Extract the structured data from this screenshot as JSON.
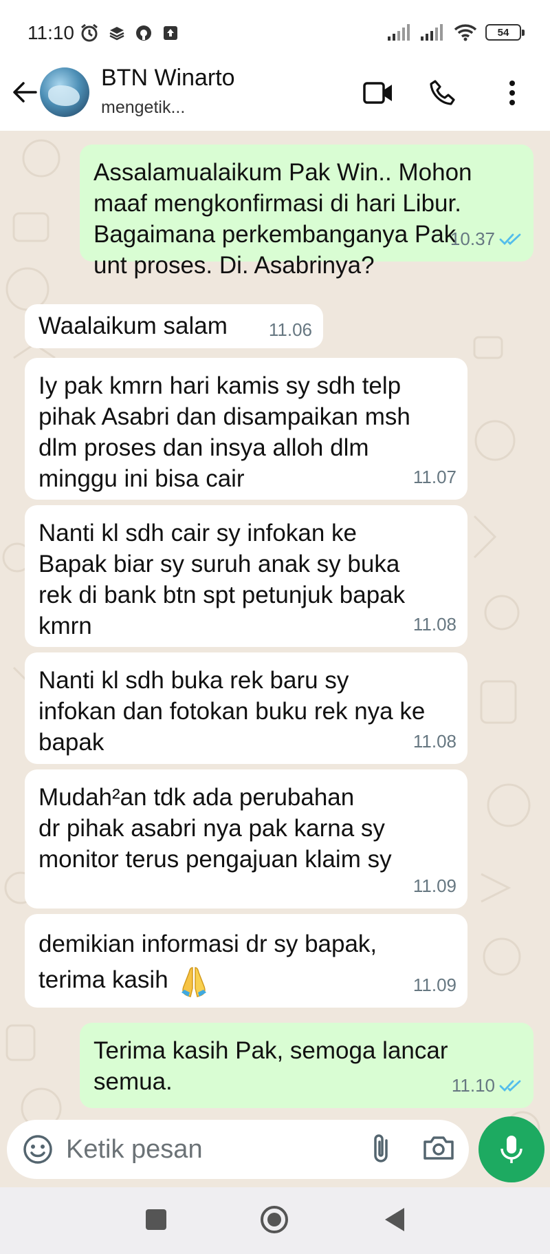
{
  "status_bar": {
    "time": "11:10",
    "battery": "54"
  },
  "header": {
    "contact_name": "BTN Winarto",
    "contact_status": "mengetik..."
  },
  "messages": [
    {
      "direction": "out",
      "text": "Assalamualaikum Pak Win.. Mohon\nmaaf mengkonfirmasi di hari Libur.\nBagaimana perkembanganya Pak\nunt proses. Di. Asabrinya?",
      "time": "10.37",
      "status": "read"
    },
    {
      "direction": "in",
      "text": "Waalaikum salam",
      "time": "11.06"
    },
    {
      "direction": "in",
      "text": "Iy pak kmrn hari kamis sy sdh telp\npihak Asabri dan disampaikan msh\ndlm proses dan insya alloh dlm\nminggu ini bisa cair",
      "time": "11.07"
    },
    {
      "direction": "in",
      "text": "Nanti kl sdh cair sy infokan ke\nBapak biar sy suruh anak sy buka\nrek di bank btn spt petunjuk bapak\nkmrn",
      "time": "11.08"
    },
    {
      "direction": "in",
      "text": "Nanti kl sdh buka rek baru sy\ninfokan dan fotokan buku rek nya ke\nbapak",
      "time": "11.08"
    },
    {
      "direction": "in",
      "text": "Mudah²an tdk ada perubahan\ndr pihak asabri nya pak karna sy\nmonitor terus pengajuan klaim sy",
      "time": "11.09"
    },
    {
      "direction": "in",
      "text": "demikian informasi dr sy bapak,\nterima kasih",
      "time": "11.09",
      "emoji": "folded-hands"
    },
    {
      "direction": "out",
      "text": "Terima kasih Pak, semoga lancar\nsemua.",
      "time": "11.10",
      "status": "read"
    }
  ],
  "input": {
    "placeholder": "Ketik pesan"
  },
  "colors": {
    "outgoing_bubble": "#d9fdd3",
    "incoming_bubble": "#ffffff",
    "chat_background": "#efe7dd",
    "accent": "#1daa61",
    "read_ticks": "#53bdeb"
  }
}
